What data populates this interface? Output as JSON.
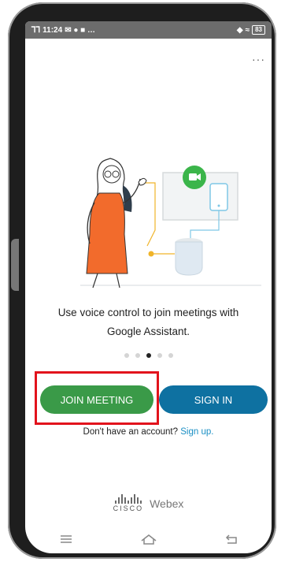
{
  "status_bar": {
    "signal_left": "⅂⅂",
    "time": "11:24",
    "notif_icons": "✉ ● ■ …",
    "battery": "83"
  },
  "menu": {
    "more_label": "···"
  },
  "content": {
    "tagline_line1": "Use voice control to join meetings with",
    "tagline_line2": "Google Assistant."
  },
  "pager": {
    "total": 5,
    "active_index": 2
  },
  "buttons": {
    "join": "JOIN MEETING",
    "sign_in": "SIGN IN"
  },
  "signup": {
    "prompt": "Don't have an account?",
    "link": "Sign up."
  },
  "brand": {
    "cisco": "CISCO",
    "webex": "Webex"
  },
  "colors": {
    "join_green": "#3a9a48",
    "sign_in_blue": "#0e71a1",
    "highlight_red": "#e2131c",
    "link_blue": "#1a8fc4",
    "camera_green": "#3bb54a"
  }
}
